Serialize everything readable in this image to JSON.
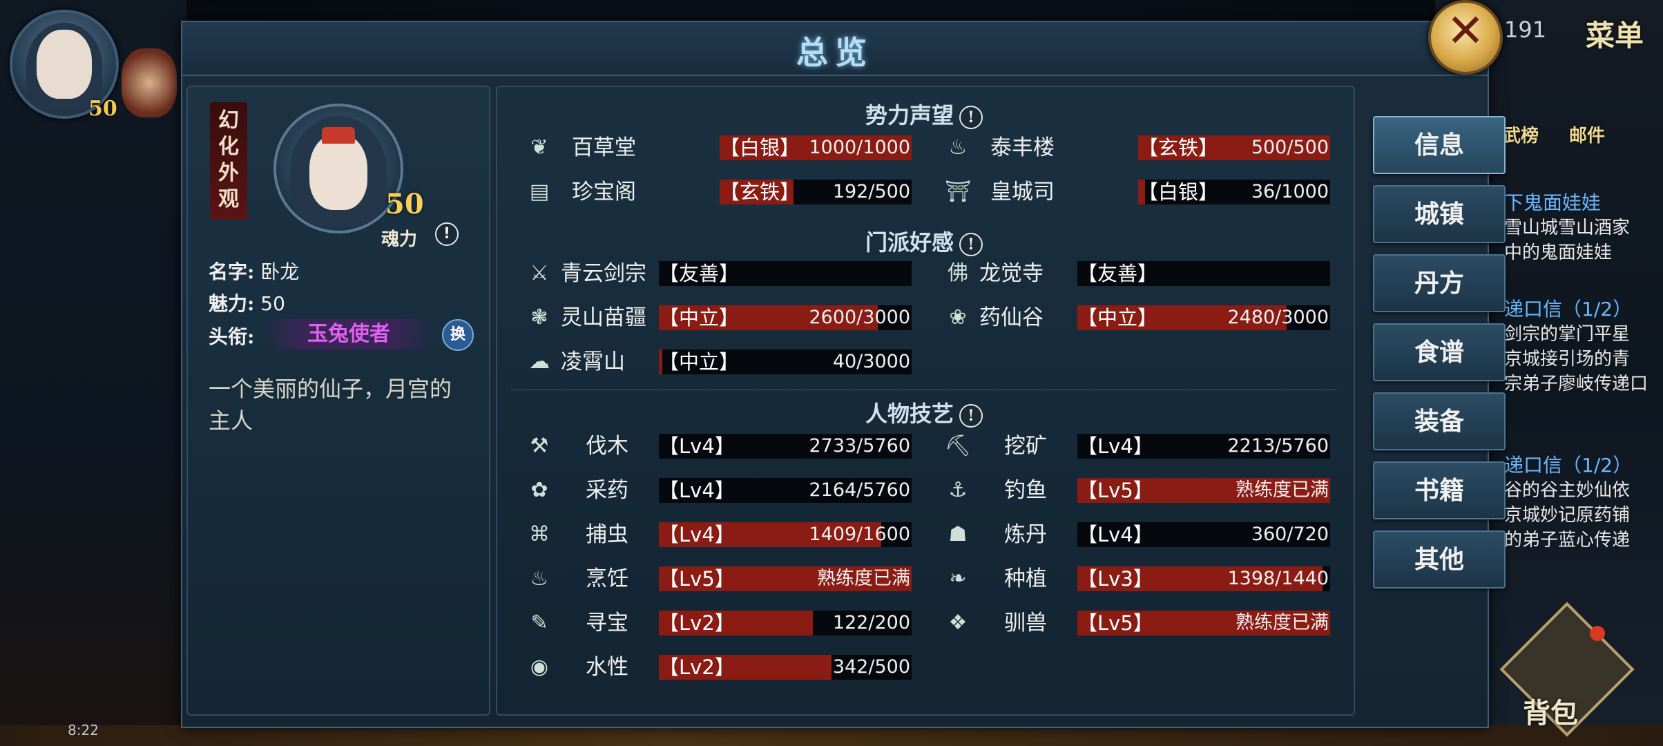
{
  "hud": {
    "player_level": "50",
    "right_number": "191",
    "menu_label": "菜单",
    "rank_label": "武榜",
    "mail_label": "邮件",
    "pack_label": "背包",
    "clock": "8:22",
    "quests": [
      {
        "title": "下鬼面娃娃",
        "lines": [
          "雪山城雪山酒家",
          "中的鬼面娃娃"
        ]
      },
      {
        "title": "递口信（1/2）",
        "lines": [
          "剑宗的掌门平星",
          "京城接引场的青",
          "宗弟子廖岐传递口"
        ],
        "highlight": "廖岐"
      },
      {
        "title": "递口信（1/2）",
        "lines": [
          "谷的谷主妙仙依",
          "京城妙记原药铺",
          "的弟子蓝心传递"
        ],
        "highlight": "蓝心"
      }
    ]
  },
  "dialog": {
    "title": "总览",
    "close_symbol": "✕"
  },
  "profile": {
    "skin_label": [
      "幻",
      "化",
      "外",
      "观"
    ],
    "soul_level": "50",
    "soul_label": "魂力",
    "name_key": "名字:",
    "name_value": "卧龙",
    "charm_key": "魅力:",
    "charm_value": "50",
    "title_key": "头衔:",
    "title_value": "玉兔使者",
    "swap_label": "换",
    "description": "一个美丽的仙子，月宫的主人"
  },
  "sections": {
    "reputation": "势力声望",
    "sect": "门派好感",
    "skills": "人物技艺"
  },
  "reputation": [
    {
      "icon": "leaf-icon",
      "glyph": "❦",
      "name": "百草堂",
      "tag": "【白银】",
      "tag_class": "silver",
      "value": "1000/1000",
      "fraction": 1.0
    },
    {
      "icon": "teapot-icon",
      "glyph": "♨",
      "name": "泰丰楼",
      "tag": "【玄铁】",
      "tag_class": "iron",
      "value": "500/500",
      "fraction": 1.0
    },
    {
      "icon": "chest-icon",
      "glyph": "▤",
      "name": "珍宝阁",
      "tag": "【玄铁】",
      "tag_class": "iron",
      "value": "192/500",
      "fraction": 0.384
    },
    {
      "icon": "palace-icon",
      "glyph": "⛩",
      "name": "皇城司",
      "tag": "【白银】",
      "tag_class": "silver",
      "value": "36/1000",
      "fraction": 0.036
    }
  ],
  "sects": [
    {
      "icon": "sword-icon",
      "glyph": "⚔",
      "name": "青云剑宗",
      "tag": "【友善】",
      "tag_class": "friend",
      "value": "",
      "fraction": 0
    },
    {
      "icon": "buddha-icon",
      "glyph": "佛",
      "name": "龙觉寺",
      "tag": "【友善】",
      "tag_class": "friend",
      "value": "",
      "fraction": 0
    },
    {
      "icon": "butterfly-icon",
      "glyph": "❃",
      "name": "灵山苗疆",
      "tag": "【中立】",
      "tag_class": "neutral",
      "value": "2600/3000",
      "fraction": 0.8667
    },
    {
      "icon": "lotus-icon",
      "glyph": "❀",
      "name": "药仙谷",
      "tag": "【中立】",
      "tag_class": "neutral",
      "value": "2480/3000",
      "fraction": 0.8267
    },
    {
      "icon": "cloud-icon",
      "glyph": "☁",
      "name": "凌霄山",
      "tag": "【中立】",
      "tag_class": "neutral",
      "value": "40/3000",
      "fraction": 0.0133
    }
  ],
  "skills": [
    {
      "icon": "axe-icon",
      "glyph": "⚒",
      "name": "伐木",
      "level": "【Lv4】",
      "value": "2733/5760",
      "fraction": 0
    },
    {
      "icon": "pickaxe-icon",
      "glyph": "⛏",
      "name": "挖矿",
      "level": "【Lv4】",
      "value": "2213/5760",
      "fraction": 0
    },
    {
      "icon": "herb-icon",
      "glyph": "✿",
      "name": "采药",
      "level": "【Lv4】",
      "value": "2164/5760",
      "fraction": 0
    },
    {
      "icon": "fishing-icon",
      "glyph": "⚓",
      "name": "钓鱼",
      "level": "【Lv5】",
      "value": "熟练度已满",
      "fraction": 1.0
    },
    {
      "icon": "net-icon",
      "glyph": "⌘",
      "name": "捕虫",
      "level": "【Lv4】",
      "value": "1409/1600",
      "fraction": 0.8806
    },
    {
      "icon": "furnace-icon",
      "glyph": "☗",
      "name": "炼丹",
      "level": "【Lv4】",
      "value": "360/720",
      "fraction": 0
    },
    {
      "icon": "cooking-icon",
      "glyph": "♨",
      "name": "烹饪",
      "level": "【Lv5】",
      "value": "熟练度已满",
      "fraction": 1.0
    },
    {
      "icon": "sprout-icon",
      "glyph": "❧",
      "name": "种植",
      "level": "【Lv3】",
      "value": "1398/1440",
      "fraction": 0.9708
    },
    {
      "icon": "scroll-icon",
      "glyph": "✎",
      "name": "寻宝",
      "level": "【Lv2】",
      "value": "122/200",
      "fraction": 0.61
    },
    {
      "icon": "paw-icon",
      "glyph": "❖",
      "name": "驯兽",
      "level": "【Lv5】",
      "value": "熟练度已满",
      "fraction": 1.0
    },
    {
      "icon": "water-icon",
      "glyph": "◉",
      "name": "水性",
      "level": "【Lv2】",
      "value": "342/500",
      "fraction": 0.684
    }
  ],
  "tabs": [
    "信息",
    "城镇",
    "丹方",
    "食谱",
    "装备",
    "书籍",
    "其他"
  ]
}
